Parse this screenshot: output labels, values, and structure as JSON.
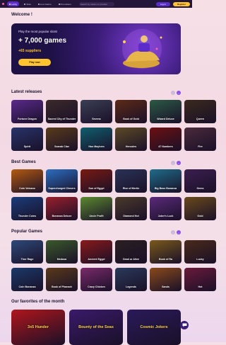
{
  "topbar": {
    "tabs": [
      {
        "label": "Lobby",
        "active": true
      },
      {
        "label": "Slots",
        "active": false
      },
      {
        "label": "Live Casino",
        "active": false
      },
      {
        "label": "Promotions",
        "active": false
      }
    ],
    "search_placeholder": "Search by casino or provider",
    "login_label": "Log in",
    "register_label": "Register"
  },
  "welcome": {
    "title": "Welcome !",
    "subtitle": "Play the most popular slots!",
    "games": "+ 7,000 games",
    "suppliers": "+65 suppliers",
    "play_label": "Play now"
  },
  "sections": {
    "latest": {
      "title": "Latest releases",
      "games": [
        {
          "name": "Fortune Dragon",
          "color": "#5a2a8c"
        },
        {
          "name": "Sacred City of Thunder",
          "color": "#3b2a2a"
        },
        {
          "name": "Sevens",
          "color": "#3a3f55"
        },
        {
          "name": "Book of Gold",
          "color": "#5c2a17"
        },
        {
          "name": "Wizard Deluxe",
          "color": "#2b5a45"
        },
        {
          "name": "Queen",
          "color": "#3a2a1c"
        },
        {
          "name": "Spirit",
          "color": "#27346b"
        },
        {
          "name": "Scarab Clan",
          "color": "#5a3b1a"
        },
        {
          "name": "Hoo Mayhem",
          "color": "#0f5f6e"
        },
        {
          "name": "Hercules",
          "color": "#5c4a25"
        },
        {
          "name": "47 Numbers",
          "color": "#6b1010"
        },
        {
          "name": "Fire",
          "color": "#4a2a3a"
        }
      ]
    },
    "best": {
      "title": "Best Games",
      "games": [
        {
          "name": "Coin Volcano",
          "color": "#b55a10"
        },
        {
          "name": "Supercharged Clovers",
          "color": "#2b6fc2"
        },
        {
          "name": "Sun of Egypt",
          "color": "#7a1a12"
        },
        {
          "name": "Rise of Merlin",
          "color": "#2a3357"
        },
        {
          "name": "Big Bass Bonanza",
          "color": "#1e6d8a"
        },
        {
          "name": "Gems",
          "color": "#3b1f4f"
        },
        {
          "name": "Thunder Coins",
          "color": "#1a3d7a"
        },
        {
          "name": "Bonanza Deluxe",
          "color": "#9a1f2b"
        },
        {
          "name": "Uncle Profit",
          "color": "#5b8a2e"
        },
        {
          "name": "Diamond Hot",
          "color": "#4a3a2a"
        },
        {
          "name": "Joker's Luck",
          "color": "#5a2a7a"
        },
        {
          "name": "Gold",
          "color": "#6a4a1a"
        }
      ]
    },
    "popular": {
      "title": "Popular Games",
      "games": [
        {
          "name": "Thor Rage",
          "color": "#2e4a7a"
        },
        {
          "name": "Medusa",
          "color": "#3a5a2a"
        },
        {
          "name": "Ancient Egypt",
          "color": "#8a1a1a"
        },
        {
          "name": "Dead or Alive",
          "color": "#2a2020"
        },
        {
          "name": "Book of Ra",
          "color": "#7a5a1a"
        },
        {
          "name": "Lucky",
          "color": "#4a2a1a"
        },
        {
          "name": "Coin Bonanza",
          "color": "#1a3a6a"
        },
        {
          "name": "Book of Pharaoh",
          "color": "#5a3a1a"
        },
        {
          "name": "Crazy Chicken",
          "color": "#7a2a6a"
        },
        {
          "name": "Legends",
          "color": "#2a3a5a"
        },
        {
          "name": "Sands",
          "color": "#8a4a1a"
        },
        {
          "name": "Hot",
          "color": "#6a1a3a"
        }
      ]
    },
    "favorites": {
      "title": "Our favorites of the month",
      "games": [
        {
          "name": "3x5 Hunder",
          "color": "#b0161c"
        },
        {
          "name": "Bounty of the Seas",
          "color": "#3a1a6a"
        },
        {
          "name": "Cosmic Jokers",
          "color": "#2a1a5a"
        }
      ]
    }
  },
  "colors": {
    "accent": "#5b2cc9",
    "cta": "#ffc42e",
    "topbar": "#24153a"
  }
}
